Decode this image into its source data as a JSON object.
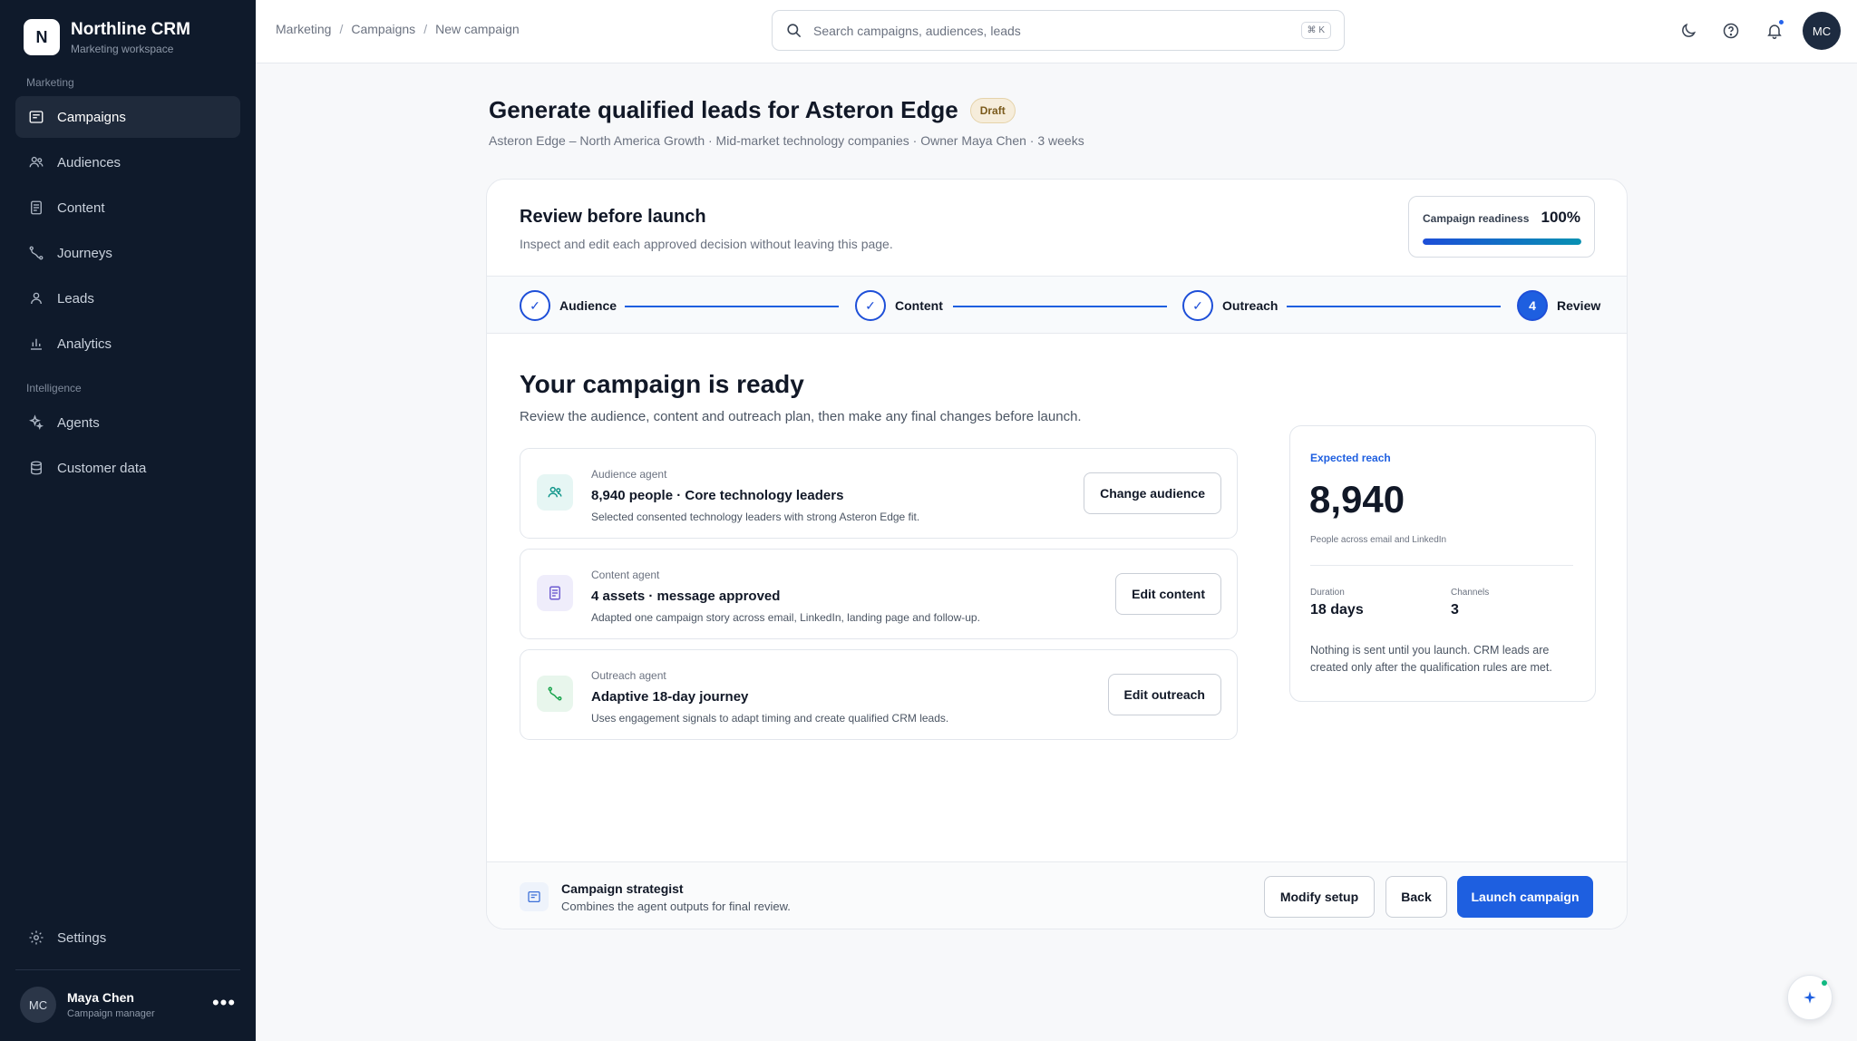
{
  "app": {
    "name": "Northline CRM",
    "workspace": "Marketing workspace",
    "logo_letter": "N"
  },
  "sidebar": {
    "section_marketing": "Marketing",
    "section_intelligence": "Intelligence",
    "items": [
      {
        "label": "Campaigns",
        "icon": "campaigns-icon",
        "active": true
      },
      {
        "label": "Audiences",
        "icon": "audiences-icon"
      },
      {
        "label": "Content",
        "icon": "content-icon"
      },
      {
        "label": "Journeys",
        "icon": "journeys-icon"
      },
      {
        "label": "Leads",
        "icon": "leads-icon"
      },
      {
        "label": "Analytics",
        "icon": "analytics-icon"
      },
      {
        "label": "Agents",
        "icon": "agents-icon"
      },
      {
        "label": "Customer data",
        "icon": "database-icon"
      }
    ],
    "settings_label": "Settings",
    "user": {
      "initials": "MC",
      "name": "Maya Chen",
      "role": "Campaign manager",
      "more": "•••"
    }
  },
  "topbar": {
    "breadcrumb": [
      "Marketing",
      "Campaigns",
      "New campaign"
    ],
    "breadcrumb_sep": "/",
    "search_placeholder": "Search campaigns, audiences, leads",
    "search_shortcut": "⌘ K",
    "avatar_initials": "MC",
    "icons": [
      "moon-icon",
      "help-icon",
      "bell-icon"
    ]
  },
  "header": {
    "title": "Generate qualified leads for Asteron Edge",
    "status": "Draft",
    "subtitle": "Asteron Edge – North America Growth · Mid-market technology companies · Owner Maya Chen · 3 weeks"
  },
  "review": {
    "title": "Review before launch",
    "subtitle": "Inspect and edit each approved decision without leaving this page.",
    "readiness_label": "Campaign readiness",
    "readiness_value": "100%",
    "readiness_fraction": 1.0
  },
  "steps": [
    {
      "label": "Audience",
      "state": "done",
      "mark": "✓"
    },
    {
      "label": "Content",
      "state": "done",
      "mark": "✓"
    },
    {
      "label": "Outreach",
      "state": "done",
      "mark": "✓"
    },
    {
      "label": "Review",
      "state": "current",
      "mark": "4"
    }
  ],
  "ready": {
    "title": "Your campaign is ready",
    "subtitle": "Review the audience, content and outreach plan, then make any final changes before launch."
  },
  "agents": [
    {
      "kicker": "Audience agent",
      "title": "8,940 people · Core technology leaders",
      "desc": "Selected consented technology leaders with strong Asteron Edge fit.",
      "button": "Change audience",
      "icon": "people-icon",
      "accent": "#0d9488",
      "tint": "#e6f6f4"
    },
    {
      "kicker": "Content agent",
      "title": "4 assets · message approved",
      "desc": "Adapted one campaign story across email, LinkedIn, landing page and follow-up.",
      "button": "Edit content",
      "icon": "document-icon",
      "accent": "#6d5bd0",
      "tint": "#efedfb"
    },
    {
      "kicker": "Outreach agent",
      "title": "Adaptive 18-day journey",
      "desc": "Uses engagement signals to adapt timing and create qualified CRM leads.",
      "button": "Edit outreach",
      "icon": "route-icon",
      "accent": "#16a34a",
      "tint": "#e8f6ec"
    }
  ],
  "reach": {
    "kicker": "Expected reach",
    "value": "8,940",
    "note": "People across email and LinkedIn",
    "duration_label": "Duration",
    "duration_value": "18 days",
    "channels_label": "Channels",
    "channels_value": "3",
    "footnote": "Nothing is sent until you launch. CRM leads are created only after the qualification rules are met."
  },
  "footer": {
    "strategist_title": "Campaign strategist",
    "strategist_sub": "Combines the agent outputs for final review.",
    "modify": "Modify setup",
    "back": "Back",
    "launch": "Launch campaign"
  },
  "colors": {
    "sidebar_bg": "#0f1a2b",
    "primary": "#1e5fe0",
    "draft_badge": "#f6eddb"
  }
}
